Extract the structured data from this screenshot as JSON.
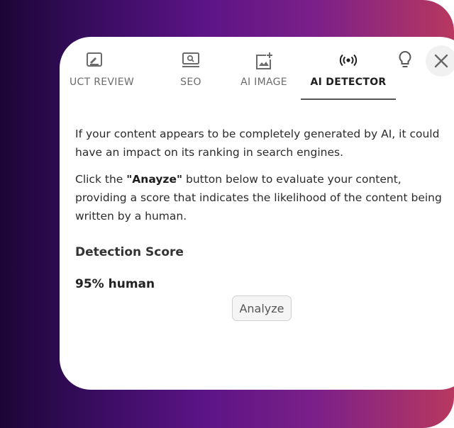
{
  "tabs": [
    {
      "label": "UCT REVIEW",
      "icon": "review-icon"
    },
    {
      "label": "SEO",
      "icon": "seo-monitor-icon"
    },
    {
      "label": "AI IMAGE",
      "icon": "add-image-icon"
    },
    {
      "label": "AI DETECTOR",
      "icon": "broadcast-icon",
      "active": true
    }
  ],
  "toolbar": {
    "tip_icon": "lightbulb-icon",
    "close_icon": "close-icon"
  },
  "detector": {
    "intro": "If your content appears to be completely generated by AI, it could have an impact on its ranking in search engines.",
    "instruction_prefix": "Click the ",
    "instruction_button_name": "\"Anayze\"",
    "instruction_suffix": " button below to evaluate your content, providing a score that indicates the likelihood of the content being written by a human.",
    "score_heading": "Detection Score",
    "score_value": "95% human",
    "analyze_label": "Analyze"
  },
  "colors": {
    "gradient_start": "#1c0636",
    "gradient_mid": "#5c1486",
    "gradient_end": "#b8385f",
    "active_tab_text": "#1f1f1f",
    "inactive_tab_text": "#6b6b6b"
  }
}
